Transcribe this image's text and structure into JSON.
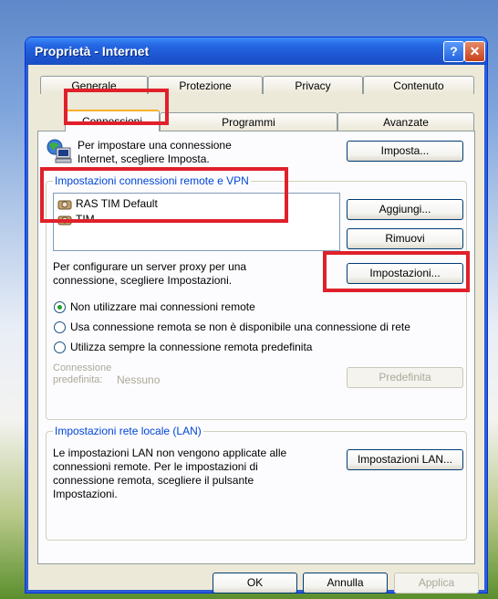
{
  "window": {
    "title": "Proprietà - Internet",
    "help_glyph": "?",
    "close_glyph": "✕"
  },
  "tabs": {
    "row1": [
      "Generale",
      "Protezione",
      "Privacy",
      "Contenuto"
    ],
    "row2": [
      "Connessioni",
      "Programmi",
      "Avanzate"
    ],
    "active": "Connessioni"
  },
  "setup": {
    "text_line1": "Per impostare una connessione",
    "text_line2": "Internet, scegliere Imposta.",
    "button": "Imposta..."
  },
  "dialup": {
    "group_label": "Impostazioni connessioni remote e VPN",
    "items": [
      "RAS TIM Default",
      "TIM"
    ],
    "add_button": "Aggiungi...",
    "remove_button": "Rimuovi",
    "proxy_text_line1": "Per configurare un server proxy per una",
    "proxy_text_line2": "connessione, scegliere Impostazioni.",
    "settings_button": "Impostazioni...",
    "options": [
      "Non utilizzare mai connessioni remote",
      "Usa connessione remota se non è disponibile una connessione di rete",
      "Utilizza sempre la connessione remota predefinita"
    ],
    "selected_option": 0,
    "default_label_line1": "Connessione",
    "default_label_line2": "predefinita:",
    "default_value": "Nessuno",
    "default_button": "Predefinita"
  },
  "lan": {
    "group_label": "Impostazioni rete locale (LAN)",
    "text": [
      "Le impostazioni LAN non vengono applicate alle",
      "connessioni remote. Per le impostazioni di",
      "connessione remota, scegliere il pulsante",
      "Impostazioni."
    ],
    "button": "Impostazioni LAN..."
  },
  "footer": {
    "ok": "OK",
    "cancel": "Annulla",
    "apply": "Applica"
  },
  "colors": {
    "highlight": "#e0202a",
    "title_bar": "#1d55d0",
    "group_label": "#0046d5"
  }
}
